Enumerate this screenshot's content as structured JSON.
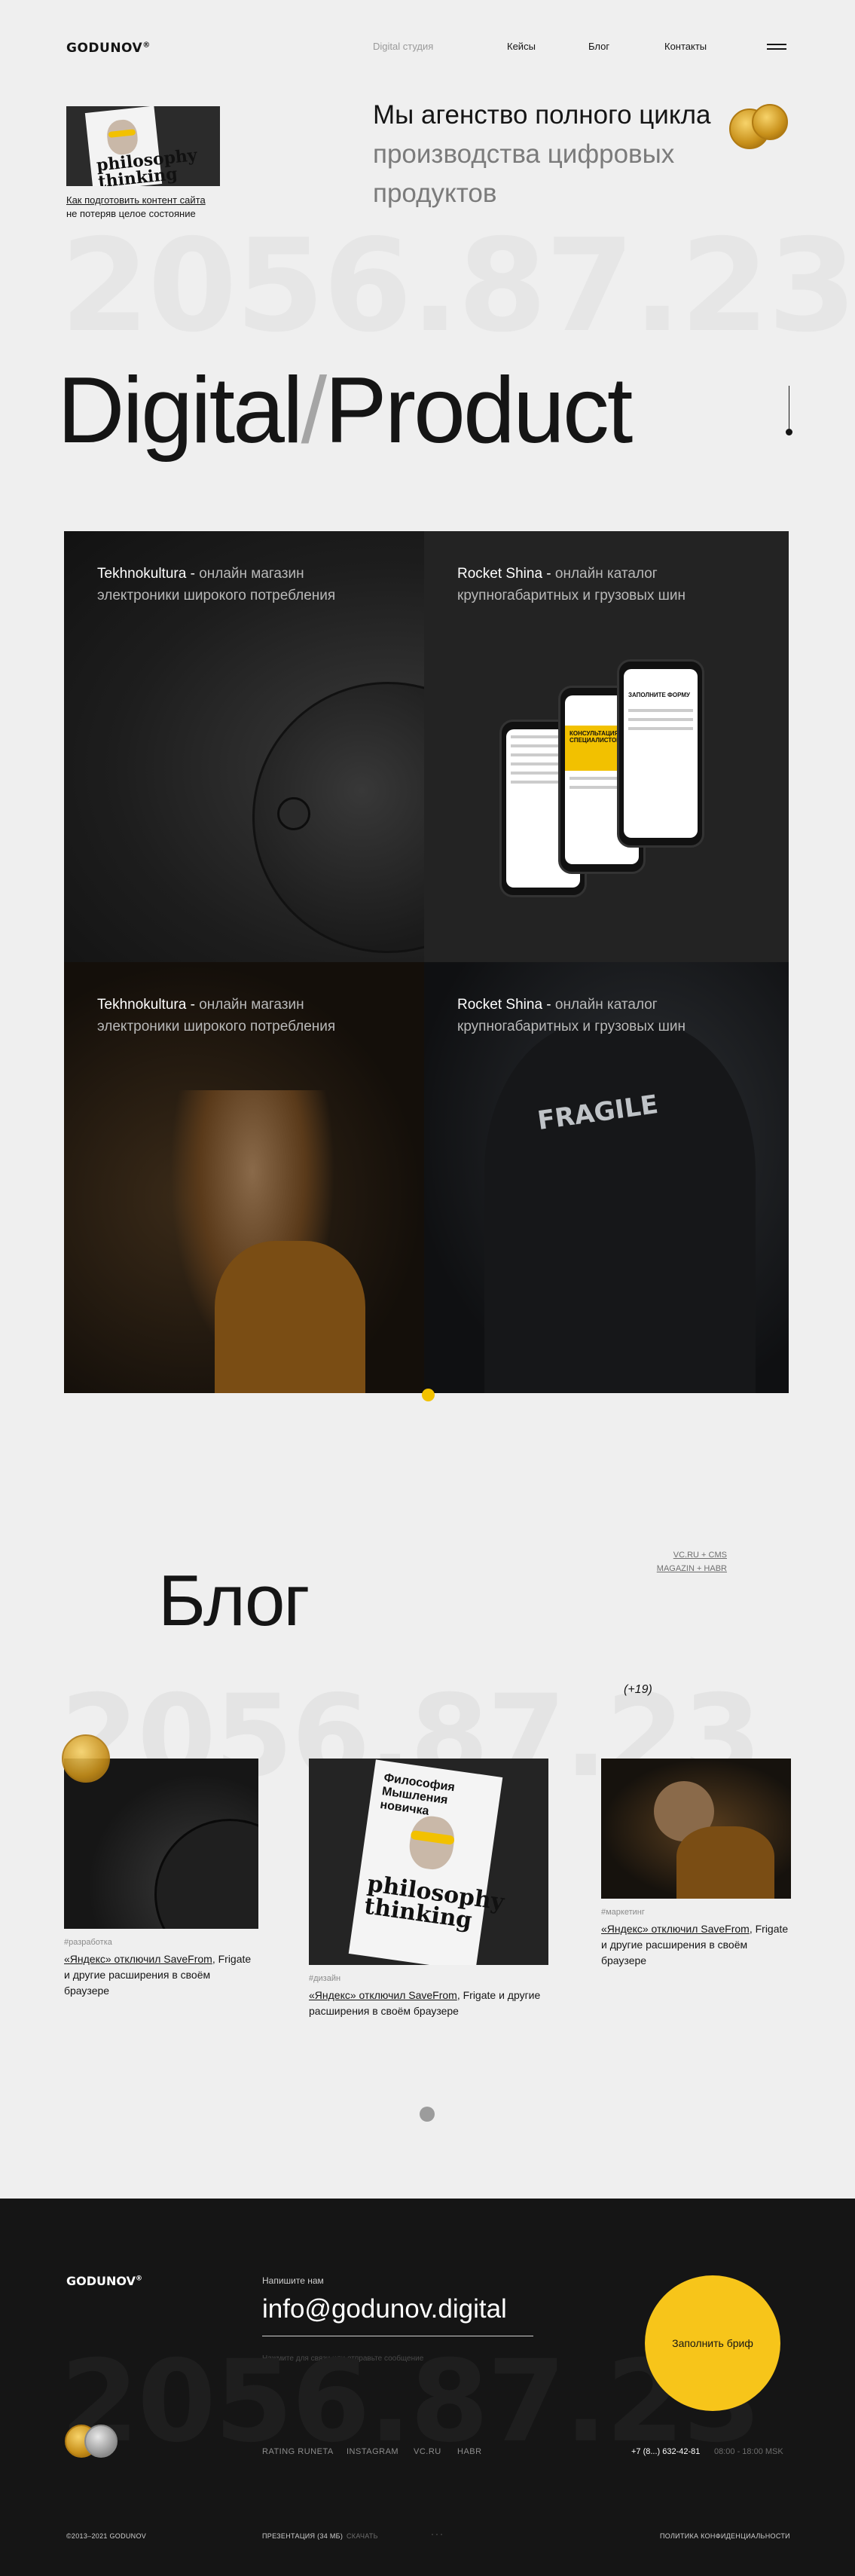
{
  "header": {
    "logo": "GODUNOV",
    "nav": [
      "Digital студия",
      "Кейсы",
      "Блог",
      "Контакты"
    ]
  },
  "hero": {
    "thumb_title": "philosophy thinking",
    "caption_link": "Как подготовить контент сайта",
    "caption_rest": "не потеряв целое состояние",
    "lead_dark": "Мы агенство полного цикла ",
    "lead_dim": "производства цифровых продуктов",
    "big_number": "2056.87.23",
    "title_left": "Digital",
    "title_slash": "/",
    "title_right": "Product"
  },
  "cases": [
    {
      "name": "Tekhnokultura",
      "desc": "онлайн магазин электроники широкого потребления"
    },
    {
      "name": "Rocket Shina",
      "desc": "онлайн каталог крупногабаритных и грузовых шин"
    },
    {
      "name": "Tekhnokultura",
      "desc": "онлайн магазин электроники широкого потребления"
    },
    {
      "name": "Rocket Shina",
      "desc": "онлайн каталог крупногабаритных и грузовых шин"
    }
  ],
  "case_phone_texts": [
    "КОНСУЛЬТАЦИЯ СПЕЦИАЛИСТОМ",
    "ЗАПОЛНИТЕ ФОРМУ"
  ],
  "case_jacket_text": "FRAGILE",
  "blog": {
    "title": "Блог",
    "links_line1": "VC.RU + CMS",
    "links_line2": "MAGAZIN + HABR",
    "count": "(+19)",
    "big_number": "2056.87.23",
    "posts": [
      {
        "tag": "#разработка",
        "link": "«Яндекс» отключил SaveFrom",
        "rest": ", Frigate и другие расширения в своём браузере"
      },
      {
        "tag": "#дизайн",
        "link": "«Яндекс» отключил SaveFrom",
        "rest": ", Frigate и другие расширения в своём браузере",
        "img_title_1": "Философия",
        "img_title_2": "Мышления",
        "img_title_3": "новичка",
        "img_sub": "philosophy thinking"
      },
      {
        "tag": "#маркетинг",
        "link": "«Яндекс» отключил SaveFrom",
        "rest": ", Frigate и другие расширения в своём браузере"
      }
    ]
  },
  "footer": {
    "logo": "GODUNOV",
    "write_label": "Напишите нам",
    "email": "info@godunov.digital",
    "agree": "Нажмите для связи или отправьте сообщение",
    "brief_button": "Заполнить бриф",
    "big_number": "2056.87.23",
    "links": [
      "RATING RUNETA",
      "INSTAGRAM",
      "VC.RU",
      "HABR"
    ],
    "phone": "+7 (8...) 632-42-81",
    "hours": "08:00 - 18:00 MSK",
    "copyright": "©2013–2021 GODUNOV",
    "presentation": "ПРЕЗЕНТАЦИЯ (34 МБ)",
    "download": "СКАЧАТЬ",
    "privacy": "ПОЛИТИКА КОНФИДЕНЦИАЛЬНОСТИ"
  },
  "colors": {
    "accent": "#f2c100",
    "dark": "#151515",
    "bg": "#efefef"
  }
}
